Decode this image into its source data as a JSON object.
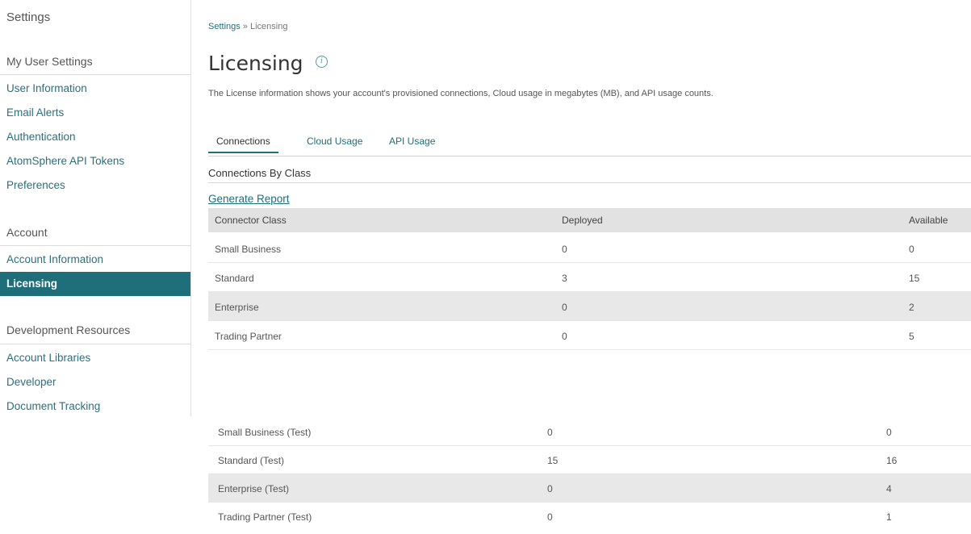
{
  "sidebar": {
    "title": "Settings",
    "sections": [
      {
        "heading": "My User Settings",
        "items": [
          "User Information",
          "Email Alerts",
          "Authentication",
          "AtomSphere API Tokens",
          "Preferences"
        ]
      },
      {
        "heading": "Account",
        "items": [
          "Account Information",
          "Licensing"
        ]
      },
      {
        "heading": "Development Resources",
        "items": [
          "Account Libraries",
          "Developer",
          "Document Tracking"
        ]
      }
    ],
    "active_item": "Licensing"
  },
  "breadcrumb": {
    "parent": "Settings",
    "separator": "»",
    "current": "Licensing"
  },
  "page": {
    "title": "Licensing",
    "description": "The License information shows your account's provisioned connections, Cloud usage in megabytes (MB), and API usage counts."
  },
  "tabs": [
    "Connections",
    "Cloud Usage",
    "API Usage"
  ],
  "active_tab": "Connections",
  "section_title": "Connections By Class",
  "generate_report": "Generate Report",
  "table": {
    "columns": [
      "Connector Class",
      "Deployed",
      "Available"
    ],
    "rows": [
      [
        "Small Business",
        "0",
        "0"
      ],
      [
        "Standard",
        "3",
        "15"
      ],
      [
        "Enterprise",
        "0",
        "2"
      ],
      [
        "Trading Partner",
        "0",
        "5"
      ]
    ],
    "test_rows": [
      [
        "Small Business (Test)",
        "0",
        "0"
      ],
      [
        "Standard (Test)",
        "15",
        "16"
      ],
      [
        "Enterprise (Test)",
        "0",
        "4"
      ],
      [
        "Trading Partner (Test)",
        "0",
        "1"
      ]
    ]
  }
}
